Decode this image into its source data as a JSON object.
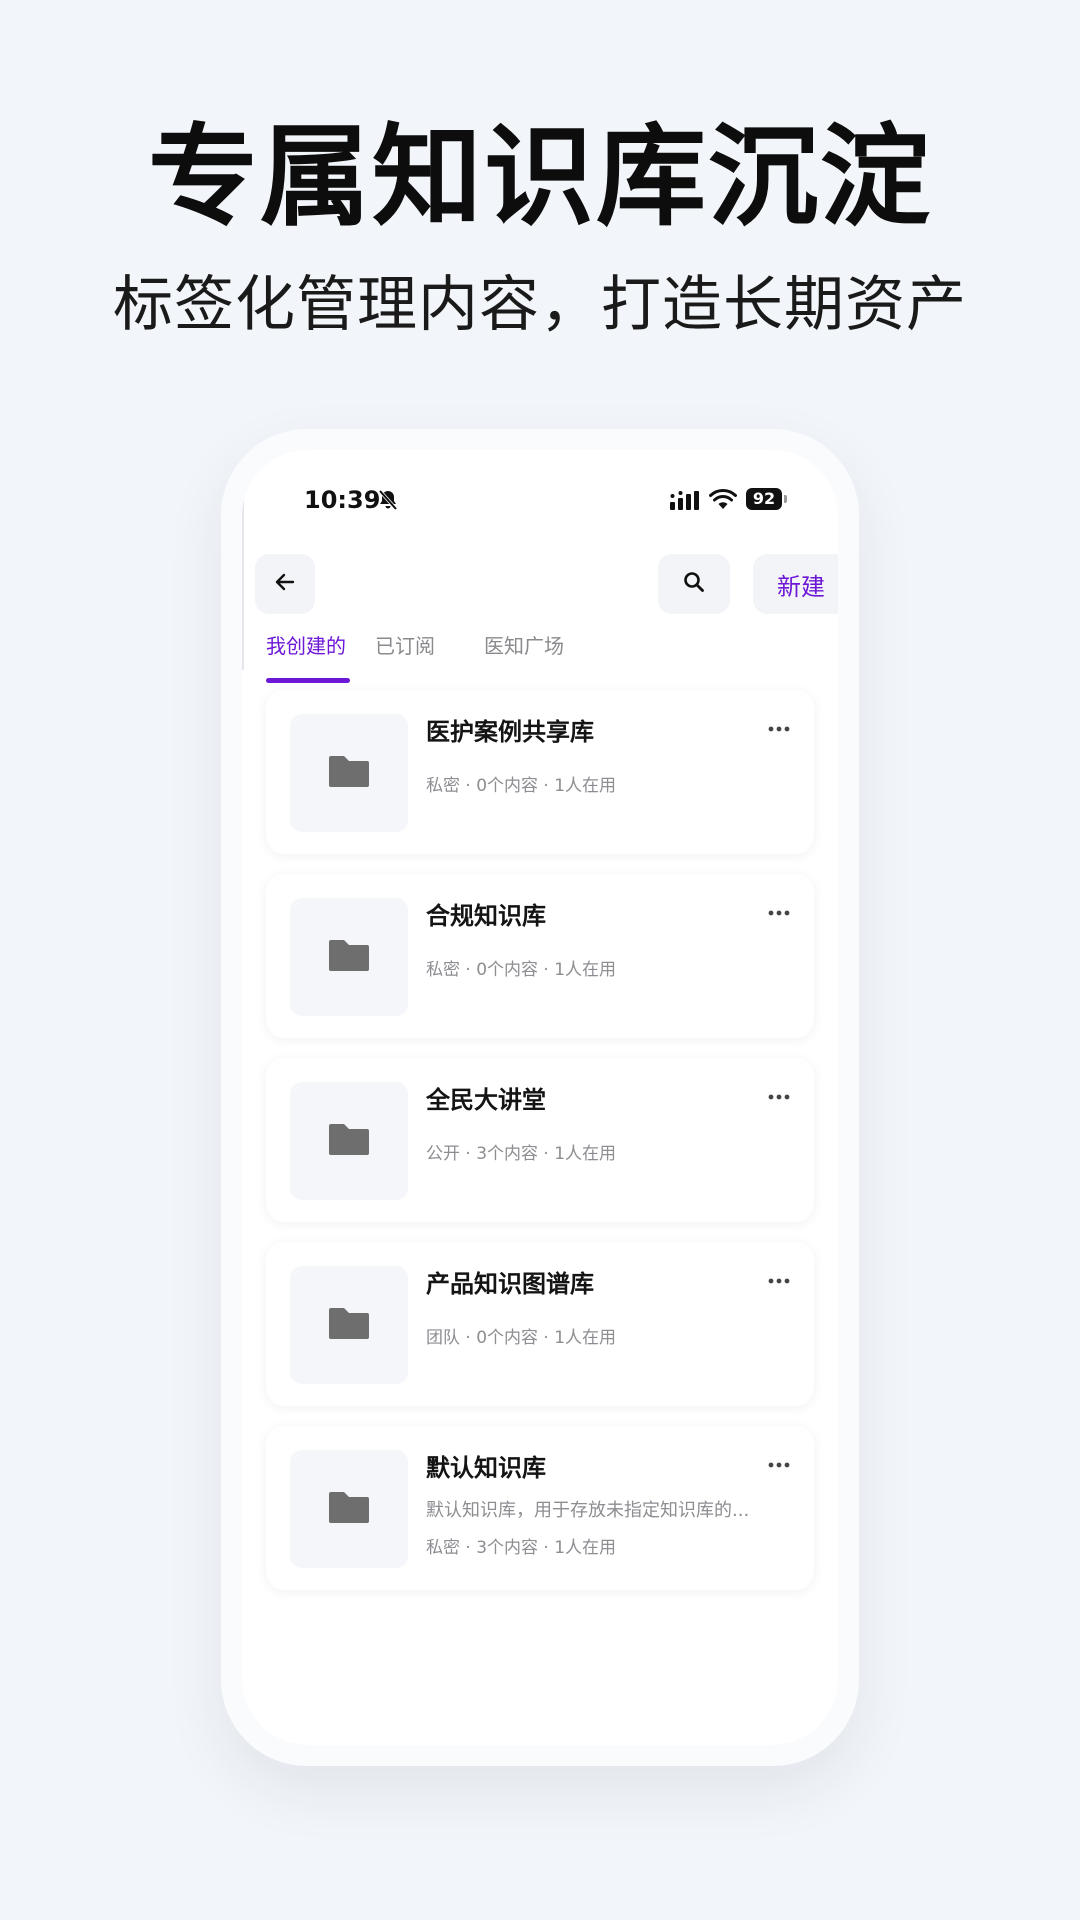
{
  "hero": {
    "title": "专属知识库沉淀",
    "subtitle": "标签化管理内容，打造长期资产"
  },
  "status_bar": {
    "time": "10:39",
    "battery": "92",
    "icons": [
      "bell-slash-icon",
      "signal-icon",
      "wifi-icon",
      "battery-icon"
    ]
  },
  "header": {
    "back_icon": "arrow-left-icon",
    "search_icon": "search-icon",
    "new_label": "新建"
  },
  "tabs": [
    {
      "label": "我创建的",
      "active": true
    },
    {
      "label": "已订阅",
      "active": false
    },
    {
      "label": "医知广场",
      "active": false
    }
  ],
  "knowledge_bases": [
    {
      "title": "医护案例共享库",
      "meta": "私密 · 0个内容 · 1人在用",
      "description": ""
    },
    {
      "title": "合规知识库",
      "meta": "私密 · 0个内容 · 1人在用",
      "description": ""
    },
    {
      "title": "全民大讲堂",
      "meta": "公开 · 3个内容 · 1人在用",
      "description": ""
    },
    {
      "title": "产品知识图谱库",
      "meta": "团队 · 0个内容 · 1人在用",
      "description": ""
    },
    {
      "title": "默认知识库",
      "meta": "私密 · 3个内容 · 1人在用",
      "description": "默认知识库，用于存放未指定知识库的..."
    }
  ],
  "colors": {
    "accent": "#6d18d6",
    "page_bg": "#f2f5f9",
    "folder_icon": "#6e6e6e"
  }
}
